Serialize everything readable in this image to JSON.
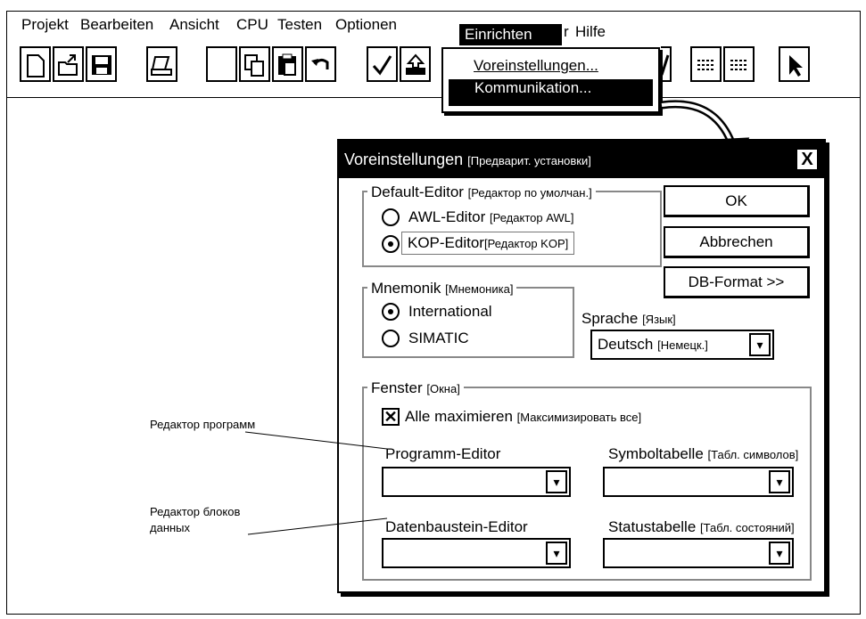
{
  "menubar": {
    "items": [
      {
        "label": "Projekt"
      },
      {
        "label": "Bearbeiten"
      },
      {
        "label": "Ansicht"
      },
      {
        "label": "CPU"
      },
      {
        "label": "Testen"
      },
      {
        "label": "Optionen"
      },
      {
        "label": "Einrichten"
      },
      {
        "label": "Hilfe"
      }
    ],
    "hidden_fragment": "r"
  },
  "toolbar": {
    "buttons": [
      "new-file-icon",
      "open-folder-icon",
      "save-disk-icon",
      "print-icon",
      "cut-icon",
      "copy-icon",
      "paste-icon",
      "undo-icon",
      "check-icon",
      "upload-icon",
      "edit-pencil-icon",
      "list-icon",
      "list-icon",
      "pointer-arrow-icon"
    ]
  },
  "einrichten_menu": {
    "items": [
      {
        "label": "Voreinstellungen..."
      },
      {
        "label": "Kommunikation..."
      }
    ]
  },
  "dialog": {
    "title": "Voreinstellungen",
    "title_ru": "[Предварит. установки]",
    "close": "X",
    "default_editor": {
      "label": "Default-Editor",
      "label_ru": "[Редактор по умолчан.]",
      "options": [
        {
          "label": "AWL-Editor",
          "ru": "[Редактор AWL]",
          "checked": false
        },
        {
          "label": "KOP-Editor",
          "ru": "[Редактор KOP]",
          "checked": true
        }
      ]
    },
    "buttons": {
      "ok": "OK",
      "cancel": "Abbrechen",
      "dbformat": "DB-Format >>"
    },
    "mnemonik": {
      "label": "Mnemonik",
      "label_ru": "[Мнемоника]",
      "options": [
        {
          "label": "International",
          "checked": true
        },
        {
          "label": "SIMATIC",
          "checked": false
        }
      ]
    },
    "sprache": {
      "label": "Sprache",
      "label_ru": "[Язык]",
      "value": "Deutsch",
      "value_ru": "[Немецк.]"
    },
    "fenster": {
      "label": "Fenster",
      "label_ru": "[Окна]",
      "alle": {
        "label": "Alle maximieren",
        "ru": "[Максимизировать все]",
        "checked": true
      },
      "programm_editor": {
        "label": "Programm-Editor",
        "value": ""
      },
      "symboltabelle": {
        "label": "Symboltabelle",
        "ru": "[Табл. символов]",
        "value": ""
      },
      "datenbaustein_editor": {
        "label": "Datenbaustein-Editor",
        "value": ""
      },
      "statustabelle": {
        "label": "Statustabelle",
        "ru": "[Табл. состояний]",
        "value": ""
      }
    }
  },
  "annotations": {
    "program_editor": "Редактор программ",
    "data_block_editor": "Редактор блоков данных"
  }
}
